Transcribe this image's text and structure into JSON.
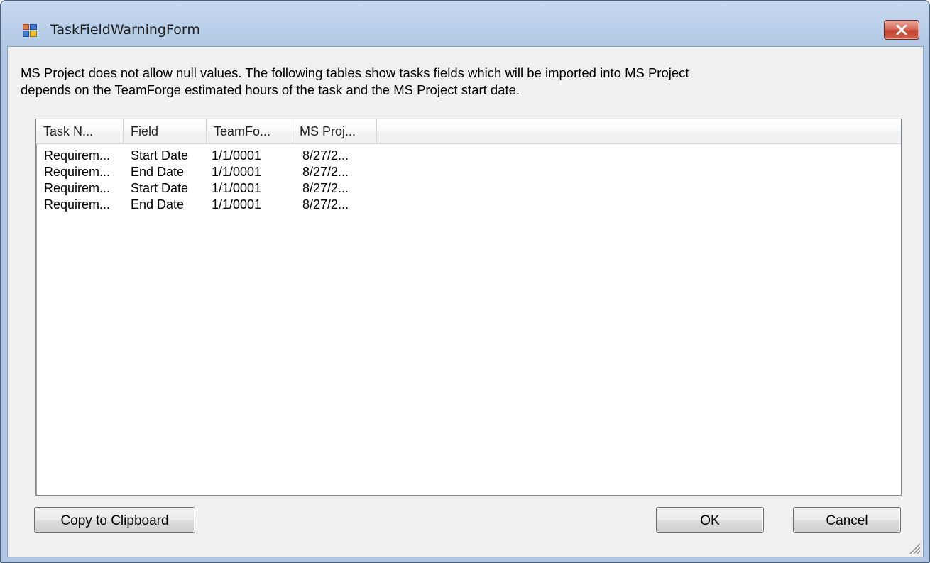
{
  "window": {
    "title": "TaskFieldWarningForm",
    "close_icon": "close-icon",
    "app_icon": "form-icon"
  },
  "message": {
    "line1": "MS Project does not allow null values. The following tables show tasks fields which will be imported into MS Project",
    "line2": "depends on the TeamForge estimated hours of the task and the MS Project start date."
  },
  "table": {
    "columns": [
      "Task N...",
      "Field",
      "TeamFo...",
      "MS Proj..."
    ],
    "rows": [
      [
        "Requirem...",
        "Start Date",
        "1/1/0001",
        "8/27/2..."
      ],
      [
        "Requirem...",
        "End Date",
        "1/1/0001",
        "8/27/2..."
      ],
      [
        "Requirem...",
        "Start Date",
        "1/1/0001",
        "8/27/2..."
      ],
      [
        "Requirem...",
        "End Date",
        "1/1/0001",
        "8/27/2..."
      ]
    ]
  },
  "buttons": {
    "copy": "Copy to Clipboard",
    "ok": "OK",
    "cancel": "Cancel"
  },
  "colors": {
    "title_bar": "#b9cfe9",
    "client_background": "#f0f0f0",
    "close_button": "#c5442f"
  }
}
